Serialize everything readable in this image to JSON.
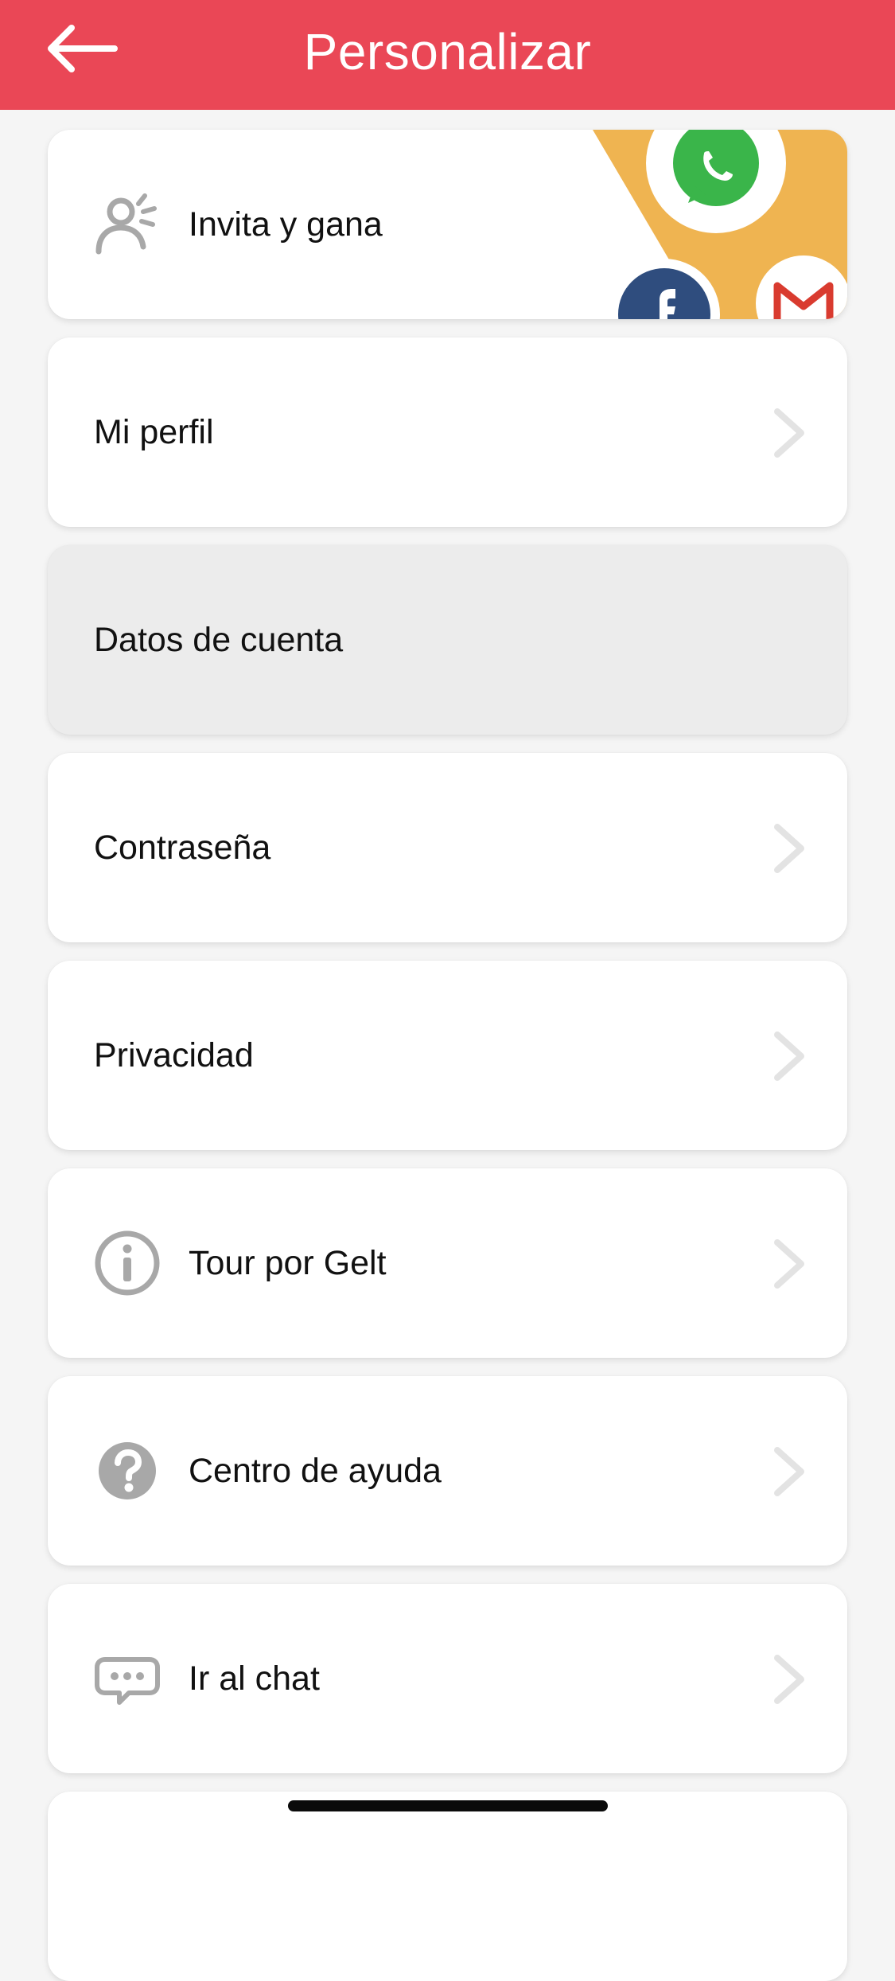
{
  "header": {
    "title": "Personalizar",
    "back_icon": "arrow-left-icon",
    "color": "#ea4756"
  },
  "menu": {
    "items": [
      {
        "label": "Invita y gana",
        "icon": "invite-person-icon",
        "promo_icons": [
          "whatsapp-icon",
          "facebook-icon",
          "gmail-icon"
        ]
      },
      {
        "label": "Mi perfil",
        "icon": "chevron-right-icon"
      },
      {
        "label": "Datos de cuenta",
        "state": "selected"
      },
      {
        "label": "Contraseña",
        "icon": "chevron-right-icon"
      },
      {
        "label": "Privacidad",
        "icon": "chevron-right-icon"
      },
      {
        "label": "Tour por Gelt",
        "icon": "info-icon"
      },
      {
        "label": "Centro de ayuda",
        "icon": "help-icon"
      },
      {
        "label": "Ir al chat",
        "icon": "chat-bubble-icon"
      }
    ]
  },
  "colors": {
    "accent": "#ea4756",
    "promo_yellow": "#efb451",
    "icon_gray": "#a8a8a8",
    "chevron_gray": "#e3e3e3",
    "selected_bg": "#ececec"
  }
}
